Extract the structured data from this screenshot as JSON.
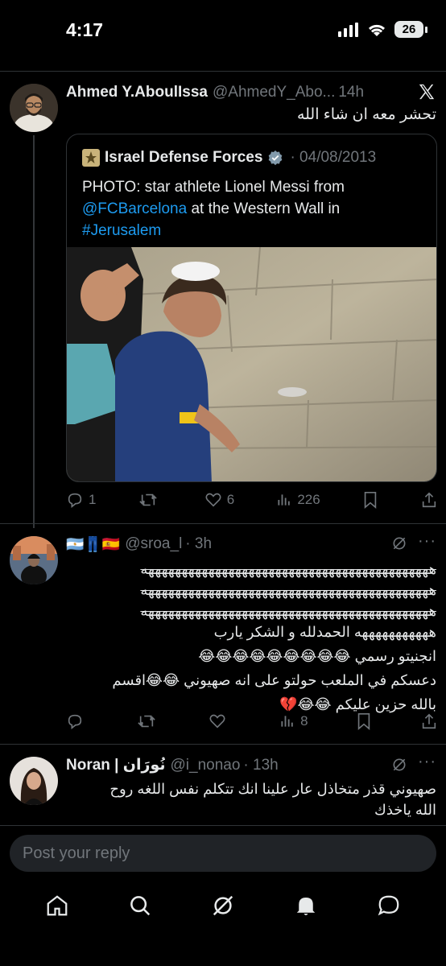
{
  "status_bar": {
    "time": "4:17",
    "battery": "26"
  },
  "tweet_main": {
    "name": "Ahmed Y.AboulIssa",
    "handle": "@AhmedY_Abo...",
    "time": "14h",
    "text": "تحشر معه ان شاء الله"
  },
  "quote": {
    "name": "Israel Defense Forces",
    "date": "· 04/08/2013",
    "text_1": "PHOTO: star athlete Lionel Messi from",
    "link_1": "@FCBarcelona",
    "text_2": " at the Western Wall in",
    "hashtag": "#Jerusalem"
  },
  "main_actions": {
    "replies": "1",
    "retweets": "",
    "likes": "6",
    "views": "226"
  },
  "reply_1": {
    "flags": "🇦🇷👖🇪🇸",
    "handle": "@sroa_l",
    "time": "· 3h",
    "line_1": "هههههههههههههههههههههههههههههههههههههههههههه",
    "line_2": "هههههههههههههههههههههههههههههههههههههههههههه",
    "line_3": "هههههههههههههههههههههههههههههههههههههههههههه",
    "line_4": "هههههههههههه الحمدلله و الشكر يارب",
    "line_5": "انجنيتو رسمي 😂😂😂😂😂😂😂😂😂",
    "line_6": "دعسكم في الملعب حولتو على انه صهيوني 😂😂اقسم",
    "line_7": "بالله حزين عليكم 😂😂💔"
  },
  "reply_1_actions": {
    "replies": "",
    "retweets": "",
    "likes": "",
    "views": "8"
  },
  "reply_2": {
    "name": "Noran | نُورَان",
    "handle": "@i_nonao",
    "time": "· 13h",
    "line_1": "صهيوني قذر متخاذل عار علينا انك تتكلم نفس اللغه روح",
    "line_2": "الله ياخذك"
  },
  "composer": {
    "placeholder": "Post your reply"
  },
  "icons": {
    "x_logo": "x-logo-icon",
    "verified": "verified-badge-icon",
    "grok": "grok-icon",
    "nav": [
      "home-icon",
      "search-icon",
      "grok-icon",
      "notifications-icon",
      "messages-icon"
    ]
  },
  "colors": {
    "background": "#000000",
    "accent": "#1d9bf0",
    "muted": "#71767b",
    "text": "#e7e9ea",
    "verified": "#829aab"
  }
}
